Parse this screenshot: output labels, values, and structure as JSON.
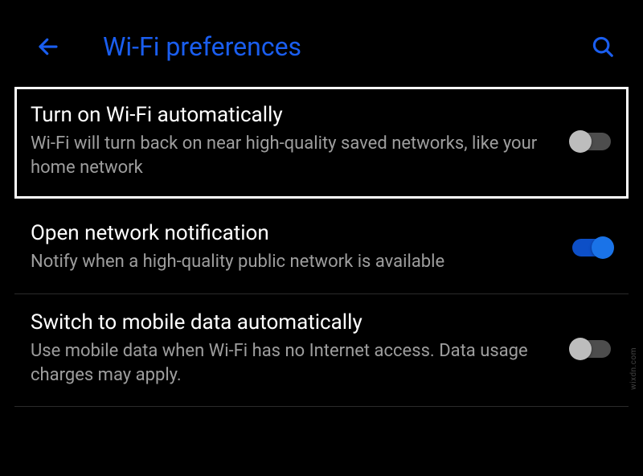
{
  "header": {
    "title": "Wi-Fi preferences"
  },
  "settings": [
    {
      "title": "Turn on Wi-Fi automatically",
      "description": "Wi-Fi will turn back on near high-quality saved networks, like your home network",
      "enabled": false,
      "highlighted": true
    },
    {
      "title": "Open network notification",
      "description": "Notify when a high-quality public network is available",
      "enabled": true,
      "highlighted": false
    },
    {
      "title": "Switch to mobile data automatically",
      "description": "Use mobile data when Wi-Fi has no Internet access. Data usage charges may apply.",
      "enabled": false,
      "highlighted": false
    }
  ],
  "watermark": "wixdn.com"
}
